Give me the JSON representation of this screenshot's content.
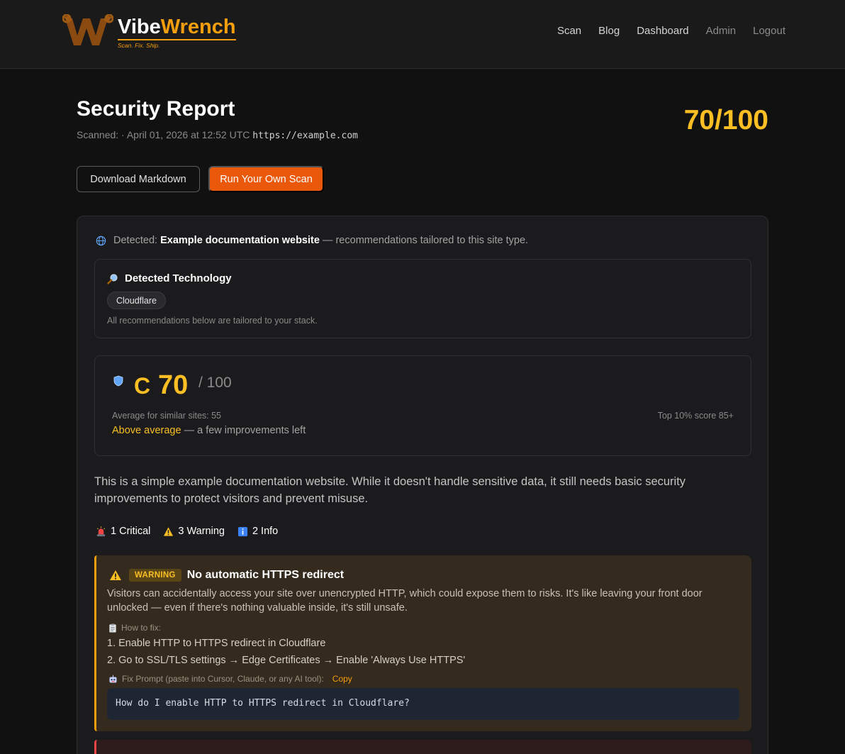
{
  "header": {
    "brand_first": "Vibe",
    "brand_second": "Wrench",
    "tagline": "Scan. Fix. Ship.",
    "nav": [
      {
        "label": "Scan"
      },
      {
        "label": "Blog"
      },
      {
        "label": "Dashboard"
      },
      {
        "label": "Admin"
      },
      {
        "label": "Logout"
      }
    ]
  },
  "report": {
    "title": "Security Report",
    "scanned_prefix": "Scanned:  · April 01, 2026 at 12:52 UTC",
    "url": "https://example.com",
    "score": "70/100"
  },
  "actions": {
    "download_label": "Download Markdown",
    "run_label": "Run Your Own Scan"
  },
  "detected": {
    "prefix": "Detected:",
    "site_type": "Example documentation website",
    "suffix": "— recommendations tailored to this site type."
  },
  "technology": {
    "title": "Detected Technology",
    "items": [
      "Cloudflare"
    ],
    "note": "All recommendations below are tailored to your stack."
  },
  "score_card": {
    "grade": "C",
    "score": "70",
    "out_of": "/ 100",
    "average": "Average for similar sites: 55",
    "top": "Top 10% score 85+",
    "standing": "Above average",
    "standing_suffix": "— a few improvements left"
  },
  "summary": "This is a simple example documentation website. While it doesn't handle sensitive data, it still needs basic security improvements to protect visitors and prevent misuse.",
  "counts": {
    "critical": "1 Critical",
    "warning": "3 Warning",
    "info": "2 Info"
  },
  "findings": [
    {
      "severity": "WARNING",
      "title": "No automatic HTTPS redirect",
      "description": "Visitors can accidentally access your site over unencrypted HTTP, which could expose them to risks. It's like leaving your front door unlocked — even if there's nothing valuable inside, it's still unsafe.",
      "how_to_label": "How to fix:",
      "steps": [
        "1. Enable HTTP to HTTPS redirect in Cloudflare",
        "2. Go to SSL/TLS settings → Edge Certificates → Enable 'Always Use HTTPS'"
      ],
      "prompt_label": "Fix Prompt (paste into Cursor, Claude, or any AI tool):",
      "copy_label": "Copy",
      "prompt": "How do I enable HTTP to HTTPS redirect in Cloudflare?"
    }
  ],
  "colors": {
    "accent": "#f59e0b",
    "score": "#fbbf24",
    "primary_button": "#ea580c",
    "warning_bg": "#342a1e",
    "critical_border": "#ef4444"
  }
}
